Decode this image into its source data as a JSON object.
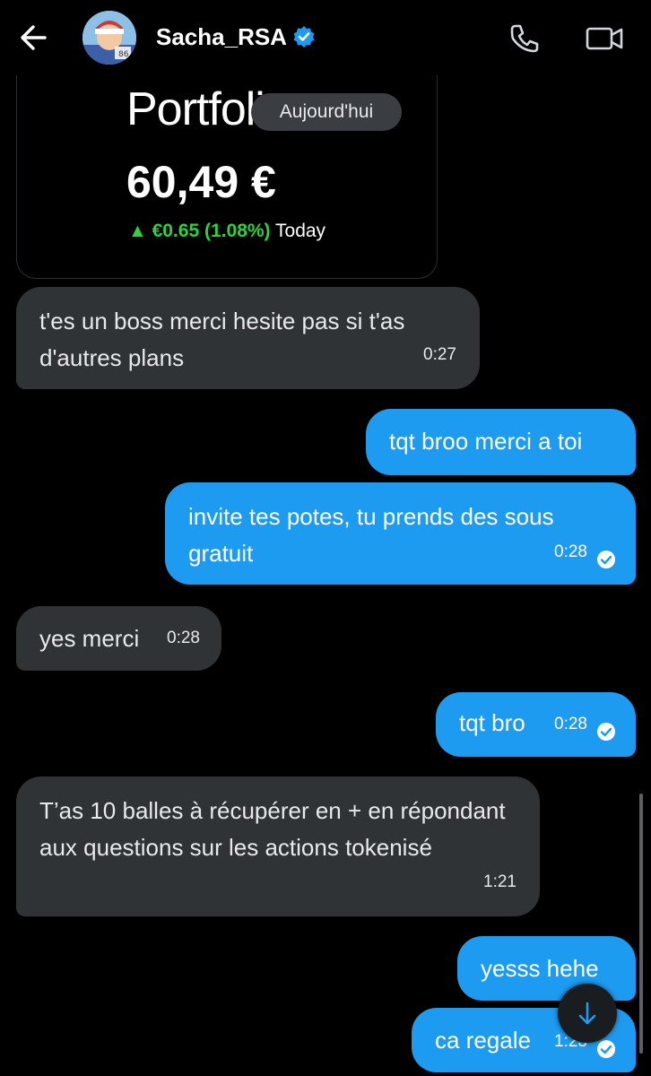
{
  "header": {
    "back_icon": "arrow-left-icon",
    "contact_name": "Sacha_RSA",
    "verified_icon": "verified-badge-icon",
    "call_icon": "phone-icon",
    "video_icon": "video-camera-icon"
  },
  "portfolio_card": {
    "title": "Portfolio",
    "value": "60,49 €",
    "change": "▲ €0.65 (1.08%)",
    "change_suffix": "Today",
    "accent": "#2cd33c"
  },
  "date_separator": "Aujourd'hui",
  "messages": [
    {
      "direction": "received",
      "text": "t'es un boss merci hesite pas si t'as d'autres plans",
      "time": "0:27"
    },
    {
      "direction": "sent",
      "text": "tqt broo merci a toi",
      "time": ""
    },
    {
      "direction": "sent",
      "text": "invite tes potes, tu prends des sous gratuit",
      "time": "0:28",
      "read": true
    },
    {
      "direction": "received",
      "text": "yes merci",
      "time": "0:28"
    },
    {
      "direction": "sent",
      "text": "tqt bro",
      "time": "0:28",
      "read": true
    },
    {
      "direction": "received",
      "text": "T’as 10 balles à récupérer en + en répondant aux questions sur les actions tokenisé",
      "time": "1:21"
    },
    {
      "direction": "sent",
      "text": "yesss hehe",
      "time": ""
    },
    {
      "direction": "sent",
      "text": "ca regale",
      "time": "1:23",
      "read": true
    }
  ],
  "colors": {
    "background": "#000000",
    "sent_bubble": "#1d9bf0",
    "received_bubble": "#2f3336",
    "verified": "#1d9bf0"
  },
  "scroll_down_icon": "arrow-down-icon"
}
